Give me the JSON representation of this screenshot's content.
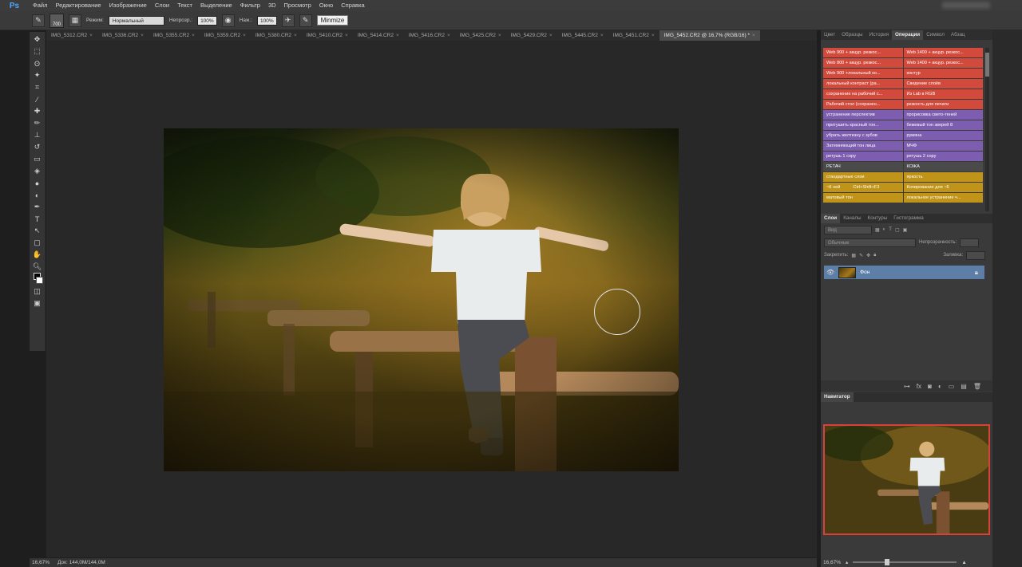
{
  "app": {
    "logo": "Ps"
  },
  "menu": [
    "Файл",
    "Редактирование",
    "Изображение",
    "Слои",
    "Текст",
    "Выделение",
    "Фильтр",
    "3D",
    "Просмотр",
    "Окно",
    "Справка"
  ],
  "options": {
    "brush_size": "700",
    "mode_label": "Режим:",
    "mode_value": "Нормальный",
    "opacity_label": "Непрозр.:",
    "opacity_value": "100%",
    "flow_label": "Наж.:",
    "flow_value": "100%",
    "tooltip": "Minmize"
  },
  "tabs": [
    "IMG_5312.CR2",
    "IMG_5336.CR2",
    "IMG_5355.CR2",
    "IMG_5359.CR2",
    "IMG_5380.CR2",
    "IMG_5410.CR2",
    "IMG_5414.CR2",
    "IMG_5416.CR2",
    "IMG_5425.CR2",
    "IMG_5429.CR2",
    "IMG_5445.CR2",
    "IMG_5451.CR2"
  ],
  "active_tab": "IMG_5452.CR2 @ 16,7% (RGB/16) *",
  "status": {
    "zoom": "16,67%",
    "doc": "Док: 144,0M/144,0M"
  },
  "panel_tabs_top": [
    "Цвет",
    "Образцы",
    "История",
    "Операции",
    "Символ",
    "Абзац"
  ],
  "panel_tabs_top_active": "Операции",
  "actions": [
    {
      "label": "Web 900 + акцур. резкос...",
      "color": "#d14a3c"
    },
    {
      "label": "Web 1400 + акцур. резкос...",
      "color": "#d14a3c"
    },
    {
      "label": "Web 800 + акцур. резкос...",
      "color": "#d14a3c"
    },
    {
      "label": "Web 1400 + акцур. резкос...",
      "color": "#d14a3c"
    },
    {
      "label": "Web 900 +локальный ко...",
      "color": "#d14a3c"
    },
    {
      "label": "контур",
      "color": "#d14a3c"
    },
    {
      "label": "локальный контраст (ра...",
      "color": "#d14a3c"
    },
    {
      "label": "Сведение слоёв",
      "color": "#d14a3c"
    },
    {
      "label": "сохранение на рабочий с...",
      "color": "#d14a3c"
    },
    {
      "label": "Из Lab в RGB",
      "color": "#d14a3c"
    },
    {
      "label": "Рабочий стол (сохранен...",
      "color": "#d14a3c"
    },
    {
      "label": "резкость для печати",
      "color": "#d14a3c"
    },
    {
      "label": "устранение перспектив",
      "color": "#7c5db0"
    },
    {
      "label": "прорисовка свето-теней",
      "color": "#7c5db0"
    },
    {
      "label": "притушить красный тон...",
      "color": "#7c5db0"
    },
    {
      "label": "бежевый тон зверей 8",
      "color": "#7c5db0"
    },
    {
      "label": "убрать желтизну с зубов",
      "color": "#7c5db0"
    },
    {
      "label": "румяна",
      "color": "#7c5db0"
    },
    {
      "label": "Затемняющий тон лица",
      "color": "#7c5db0"
    },
    {
      "label": "МЧФ",
      "color": "#7c5db0"
    },
    {
      "label": "ретушь 1 сору",
      "color": "#7c5db0"
    },
    {
      "label": "ретушь 2 сору",
      "color": "#7c5db0"
    },
    {
      "label": "РЕТАЧ",
      "color": "#4a4a4a"
    },
    {
      "label": "КОЖА",
      "color": "#4a4a4a"
    },
    {
      "label": "стандартные слои",
      "color": "#c09418"
    },
    {
      "label": "яркость",
      "color": "#c09418"
    },
    {
      "label": "~К ней",
      "color": "#c09418"
    },
    {
      "label": "Копирование для ~6",
      "color": "#c09418"
    },
    {
      "label": "матовый тон",
      "color": "#c09418"
    },
    {
      "label": "локальное устранение ч...",
      "color": "#c09418"
    }
  ],
  "action_shortcut": "Ctrl+Shift+F3",
  "layers_tabs": [
    "Слои",
    "Каналы",
    "Контуры",
    "Гистограмма"
  ],
  "layers": {
    "kind": "Вид",
    "blend": "Обычные",
    "opacity_label": "Непрозрачность:",
    "lock_label": "Закрепить:",
    "fill_label": "Заливка:",
    "layer_name": "Фон"
  },
  "navigator": {
    "title": "Навигатор",
    "zoom": "16,67%"
  }
}
